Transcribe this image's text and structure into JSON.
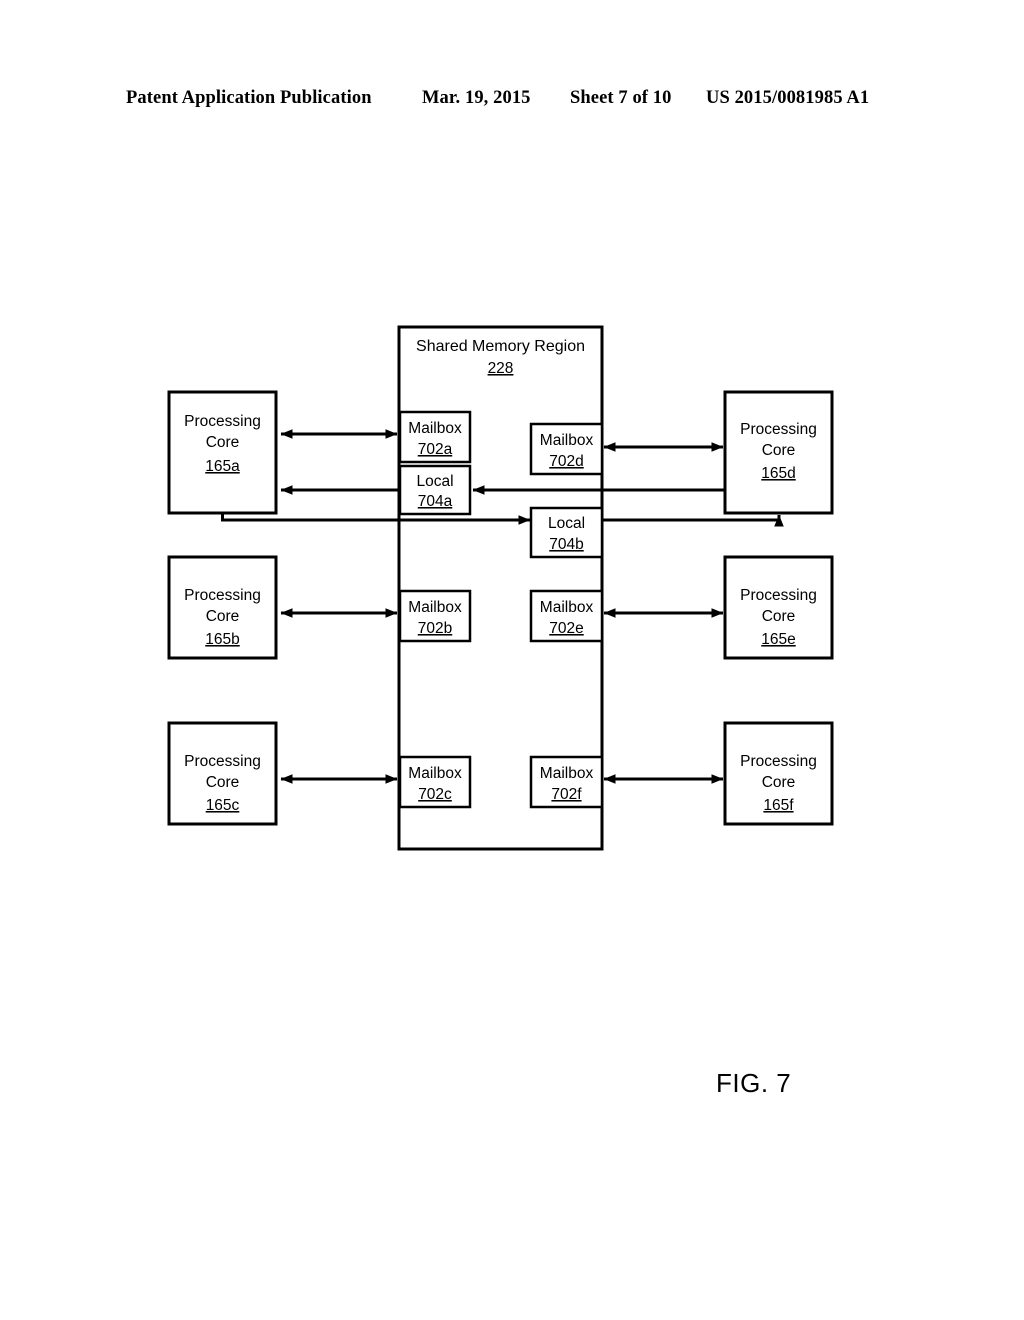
{
  "header": {
    "publication": "Patent Application Publication",
    "date": "Mar. 19, 2015",
    "sheet": "Sheet 7 of 10",
    "doc_number": "US 2015/0081985 A1"
  },
  "figure": {
    "label": "FIG. 7",
    "shared_memory": {
      "title": "Shared Memory Region",
      "ref": "228"
    },
    "cores": [
      {
        "name": "Processing",
        "name2": "Core",
        "ref": "165a"
      },
      {
        "name": "Processing",
        "name2": "Core",
        "ref": "165b"
      },
      {
        "name": "Processing",
        "name2": "Core",
        "ref": "165c"
      },
      {
        "name": "Processing",
        "name2": "Core",
        "ref": "165d"
      },
      {
        "name": "Processing",
        "name2": "Core",
        "ref": "165e"
      },
      {
        "name": "Processing",
        "name2": "Core",
        "ref": "165f"
      }
    ],
    "mailboxes": [
      {
        "name": "Mailbox",
        "ref": "702a"
      },
      {
        "name": "Mailbox",
        "ref": "702b"
      },
      {
        "name": "Mailbox",
        "ref": "702c"
      },
      {
        "name": "Mailbox",
        "ref": "702d"
      },
      {
        "name": "Mailbox",
        "ref": "702e"
      },
      {
        "name": "Mailbox",
        "ref": "702f"
      }
    ],
    "locals": [
      {
        "name": "Local",
        "ref": "704a"
      },
      {
        "name": "Local",
        "ref": "704b"
      }
    ]
  },
  "colors": {
    "ink": "#000000",
    "paper": "#ffffff"
  }
}
